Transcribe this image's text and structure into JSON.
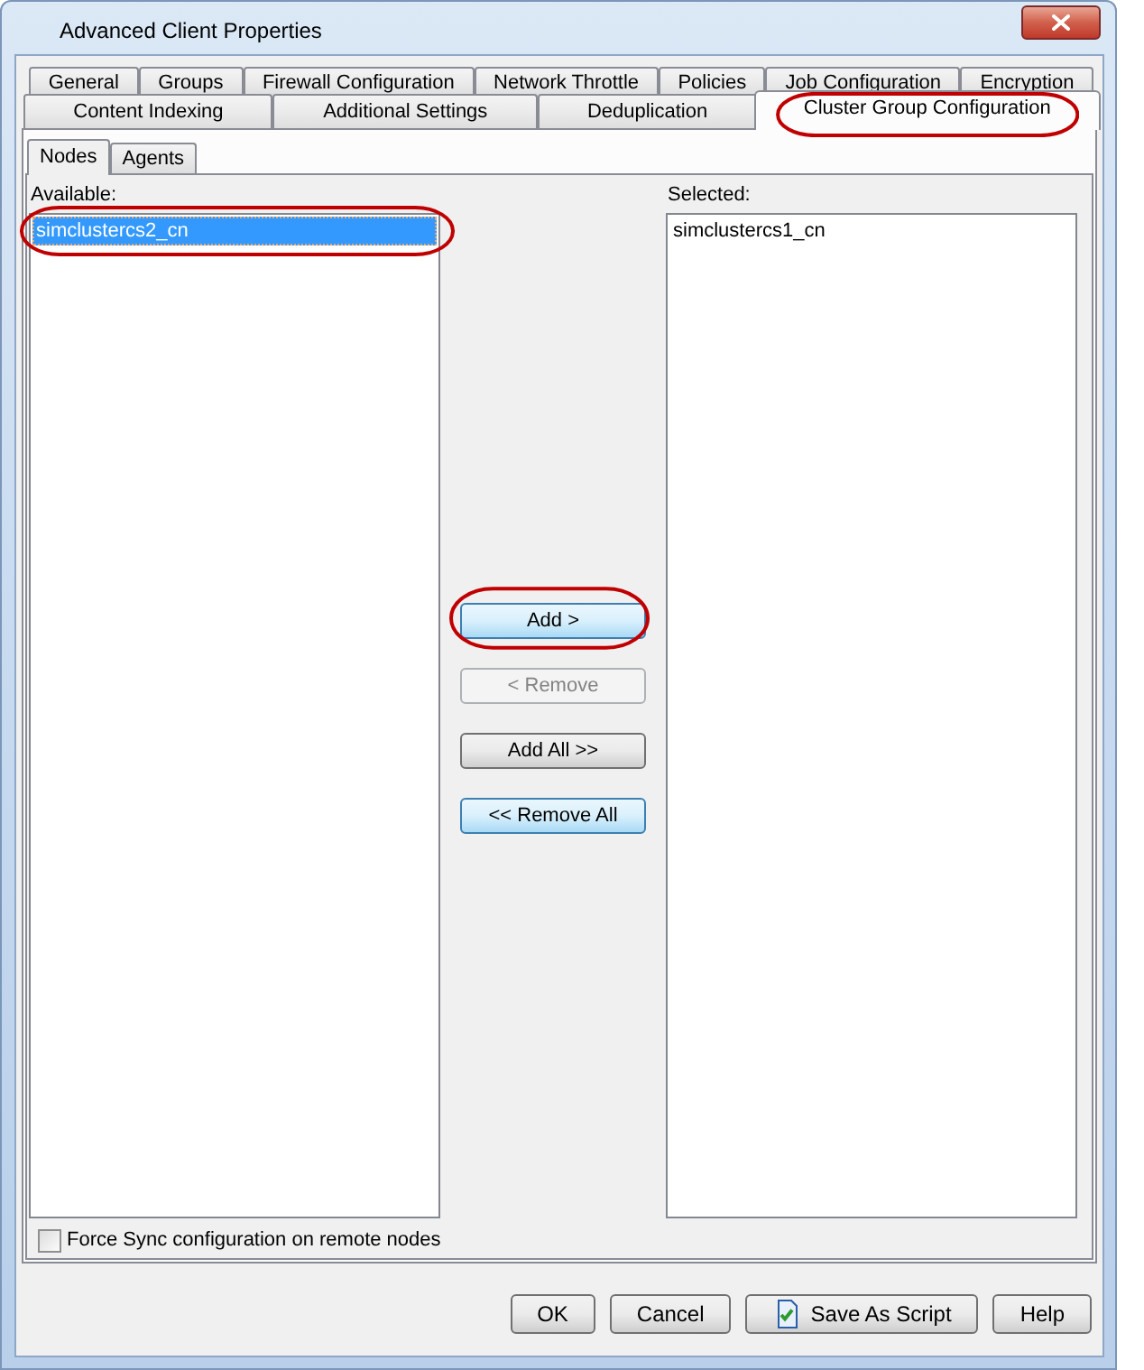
{
  "window": {
    "title": "Advanced Client Properties"
  },
  "tab_rows": [
    {
      "tabs": [
        {
          "label": "General",
          "selected": false,
          "circled": false
        },
        {
          "label": "Groups",
          "selected": false,
          "circled": false
        },
        {
          "label": "Firewall Configuration",
          "selected": false,
          "circled": false
        },
        {
          "label": "Network Throttle",
          "selected": false,
          "circled": false
        },
        {
          "label": "Policies",
          "selected": false,
          "circled": false
        },
        {
          "label": "Job Configuration",
          "selected": false,
          "circled": false
        },
        {
          "label": "Encryption",
          "selected": false,
          "circled": false
        }
      ]
    },
    {
      "tabs": [
        {
          "label": "Content Indexing",
          "selected": false,
          "circled": false
        },
        {
          "label": "Additional Settings",
          "selected": false,
          "circled": false
        },
        {
          "label": "Deduplication",
          "selected": false,
          "circled": false
        },
        {
          "label": "Cluster Group Configuration",
          "selected": true,
          "circled": true
        }
      ]
    }
  ],
  "sub_tabs": [
    {
      "label": "Nodes",
      "selected": true
    },
    {
      "label": "Agents",
      "selected": false
    }
  ],
  "available_list": {
    "label": "Available:",
    "items": [
      {
        "text": "simclustercs2_cn",
        "selected": true,
        "circled": true
      }
    ]
  },
  "transfer_buttons": [
    {
      "label": "Add >",
      "disabled": false,
      "highlighted": true,
      "circled": true
    },
    {
      "label": "< Remove",
      "disabled": true,
      "highlighted": false,
      "circled": false
    },
    {
      "label": "Add All >>",
      "disabled": false,
      "highlighted": false,
      "circled": false
    },
    {
      "label": "<< Remove All",
      "disabled": false,
      "highlighted": true,
      "circled": false
    }
  ],
  "selected_list": {
    "label": "Selected:",
    "items": [
      {
        "text": "simclustercs1_cn",
        "selected": false,
        "circled": false
      }
    ]
  },
  "force_sync": {
    "label": "Force Sync configuration on remote nodes",
    "checked": false
  },
  "dialog_buttons": [
    {
      "label": "OK",
      "kind": "plain"
    },
    {
      "label": "Cancel",
      "kind": "plain"
    },
    {
      "label": "Save As Script",
      "kind": "script"
    },
    {
      "label": "Help",
      "kind": "plain"
    }
  ]
}
